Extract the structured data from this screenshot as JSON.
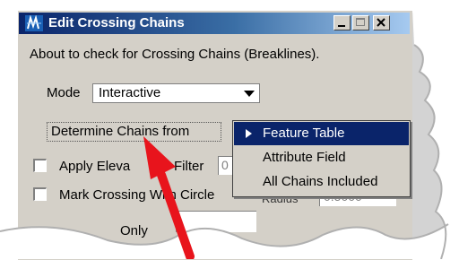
{
  "window": {
    "title": "Edit Crossing Chains",
    "controls": {
      "minimize_icon": "minimize-icon",
      "maximize_icon": "maximize-icon",
      "close_icon": "close-icon"
    }
  },
  "description": "About to check for Crossing Chains (Breaklines).",
  "mode": {
    "label": "Mode",
    "value": "Interactive"
  },
  "determine_button": {
    "label": "Determine Chains from"
  },
  "options": {
    "apply_elevation_label": "Apply Eleva",
    "filter_label": "Filter",
    "filter_value": "0",
    "mark_crossing_label": "Mark Crossing With Circle",
    "radius_label": "Radius",
    "radius_value": "0.5000",
    "only_label": "Only"
  },
  "dropdown_menu": {
    "items": [
      {
        "label": "Feature Table",
        "selected": true
      },
      {
        "label": "Attribute Field",
        "selected": false
      },
      {
        "label": "All Chains Included",
        "selected": false
      }
    ]
  },
  "colors": {
    "title_bar": "#0a246a",
    "selection": "#0a246a",
    "annotation_arrow": "#e8141c",
    "dialog_face": "#d4d0c8"
  }
}
